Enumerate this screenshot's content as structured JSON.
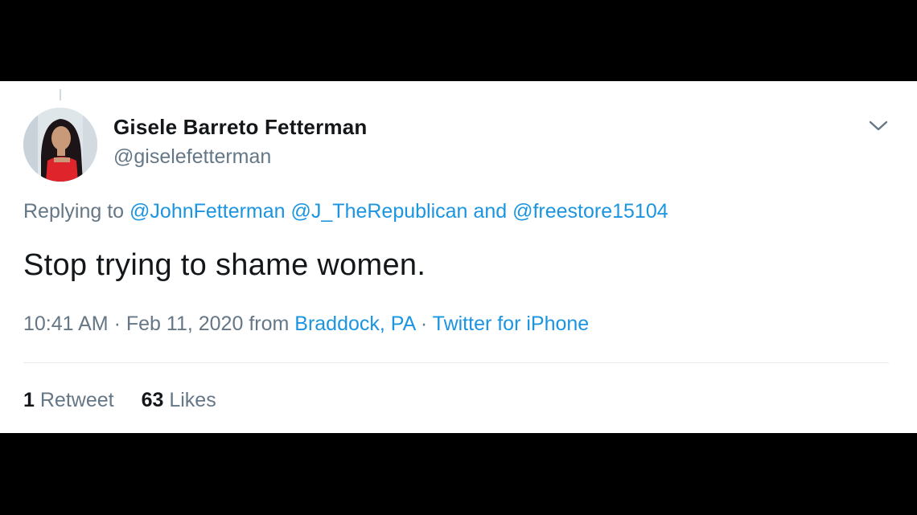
{
  "tweet": {
    "author": {
      "display_name": "Gisele Barreto Fetterman",
      "handle": "@giselefetterman",
      "avatar_icon": "profile-photo"
    },
    "menu_icon": "chevron-down-icon",
    "reply": {
      "prefix": "Replying to",
      "mention_1": "@JohnFetterman",
      "mention_2": "@J_TheRepublican",
      "conjunction": "and",
      "mention_3": "@freestore15104"
    },
    "text": "Stop trying to shame women.",
    "meta": {
      "time": "10:41 AM",
      "separator_1": "·",
      "date": "Feb 11, 2020",
      "from_label": "from",
      "location": "Braddock, PA",
      "separator_2": "·",
      "source": "Twitter for iPhone"
    },
    "stats": {
      "retweets_count": "1",
      "retweets_label": "Retweet",
      "likes_count": "63",
      "likes_label": "Likes"
    }
  },
  "colors": {
    "link": "#1b95e0",
    "secondary_text": "#657786",
    "primary_text": "#14171a",
    "letterbox": "#000000"
  }
}
